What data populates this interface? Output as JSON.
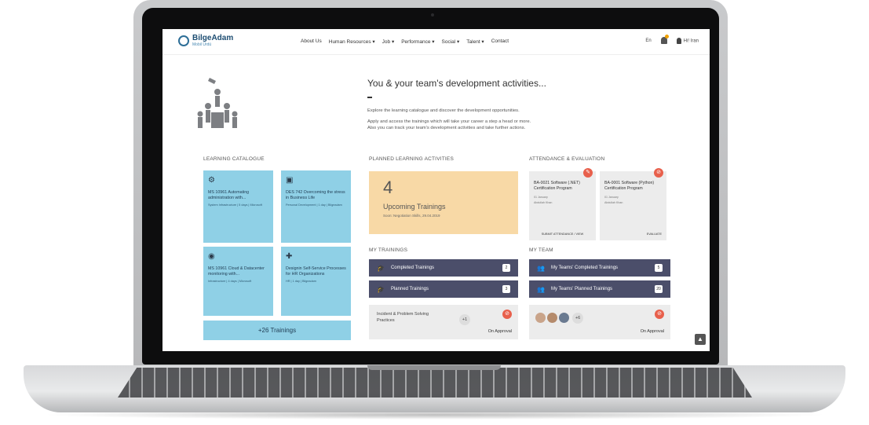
{
  "brand": {
    "name": "BilgeAdam",
    "sub": "Mobil Ürdü"
  },
  "nav": {
    "items": [
      "About Us",
      "Human Resources ▾",
      "Job ▾",
      "Performance ▾",
      "Social ▾",
      "Talent ▾",
      "Contact"
    ],
    "language": "En",
    "user": "Hi! Iran"
  },
  "hero": {
    "title": "You & your team's development activities...",
    "line1": "Explore the learning catalogue and discover the development opportunities.",
    "line2": "Apply and access the trainings which will take your career a step a head or more.",
    "line3": "Also you can track your team's development activities and take further actions."
  },
  "sections": {
    "catalogue": "LEARNING CATALOGUE",
    "planned": "PLANNED LEARNING ACTIVITIES",
    "attendance": "ATTENDANCE & EVALUATION",
    "my_trainings": "MY TRAININGS",
    "my_team": "MY TEAM"
  },
  "catalogue_tiles": [
    {
      "icon": "⚙",
      "title": "MS 10961 Automating administration with...",
      "sub": "System Infrastructure | 5 days | Microsoft"
    },
    {
      "icon": "▣",
      "title": "DES 742 Overcoming the stress in Business Life",
      "sub": "Personal Development | 1 day | Bilgeadam"
    },
    {
      "icon": "◉",
      "title": "MS 10961 Cloud & Datacenter monitoring with...",
      "sub": "Infrastructure | 4 days | Microsoft"
    },
    {
      "icon": "✚",
      "title": "Designin Self-Service Processes for HR Organizations",
      "sub": "HR | 1 day | Bilgeadam"
    }
  ],
  "catalogue_more": "+26 Trainings",
  "upcoming": {
    "count": "4",
    "label": "Upcoming Trainings",
    "sub": "Soon: Negotiation Skills, 29.04.2019"
  },
  "attendance_cards": [
    {
      "title": "BA-0021 Software (.NET) Certification Program",
      "date": "01 January",
      "name": "Abdullah Khan",
      "action": "SUBMIT ATTENDANCE / VIEW",
      "badge": "✎"
    },
    {
      "title": "BA-0001 Software (Python) Certification Program",
      "date": "01 January",
      "name": "Abdullah Khan",
      "action": "EVALUATE",
      "badge": "⊘"
    }
  ],
  "my_trainings": {
    "completed": {
      "label": "Completed Trainings",
      "count": "2"
    },
    "planned": {
      "label": "Planned Trainings",
      "count": "3"
    },
    "pending": {
      "title": "Incident & Problem Solving Practices",
      "plus": "+1",
      "status": "On Approval"
    }
  },
  "my_team": {
    "completed": {
      "label": "My Teams' Completed Trainings",
      "count": "5"
    },
    "planned": {
      "label": "My Teams' Planned Trainings",
      "count": "20"
    },
    "pending": {
      "plus": "+6",
      "status": "On Approval"
    }
  },
  "colors": {
    "tile": "#8fd0e6",
    "bar": "#4b4e6a",
    "upcoming": "#f8d9a6",
    "badge": "#e8604c"
  }
}
